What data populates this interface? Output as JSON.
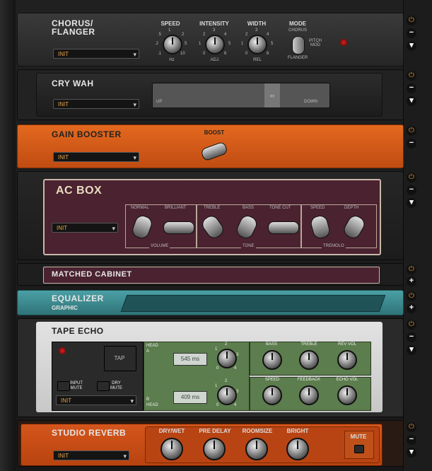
{
  "colors": {
    "orange": "#d35a1a",
    "wah": "#2e2e2e",
    "acbox": "#3a1a22",
    "teal": "#3d8a8f",
    "tape": "#dcdcdc",
    "green": "#5c7d4d"
  },
  "chorus": {
    "title": "CHORUS/\nFLANGER",
    "preset": "INIT",
    "speed": {
      "label": "SPEED",
      "min": ".1",
      "max": "10",
      "unit": "Hz",
      "t1": ".5",
      "t2": "1",
      "t3": "2",
      "t4": "5",
      "t5": ".2"
    },
    "intensity": {
      "label": "INTENSITY",
      "t": [
        "1",
        "2",
        "3",
        "4",
        "5",
        "0",
        "6"
      ],
      "unit": "ADJ."
    },
    "width": {
      "label": "WIDTH",
      "t": [
        "1",
        "2",
        "3",
        "4",
        "5",
        "0",
        "6"
      ],
      "unit": "REL"
    },
    "mode": {
      "label": "MODE",
      "top": "CHORUS",
      "right": "PITCH\nMOD",
      "bottom": "FLANGER"
    }
  },
  "wah": {
    "title": "CRY WAH",
    "preset": "INIT",
    "up": "UP",
    "down": "DOWN"
  },
  "gain": {
    "title": "GAIN BOOSTER",
    "preset": "INIT",
    "boost": "BOOST"
  },
  "acbox": {
    "title": "AC BOX",
    "preset": "INIT",
    "labels": [
      "NORMAL",
      "BRILLIANT",
      "TREBLE",
      "BASS",
      "TONE CUT",
      "SPEED",
      "DEPTH"
    ],
    "groups": [
      "VOLUME",
      "TONE",
      "TREMOLO"
    ]
  },
  "cabinet": {
    "title": "MATCHED CABINET"
  },
  "eq": {
    "title": "EQUALIZER",
    "sub": "GRAPHIC"
  },
  "tape": {
    "title": "TAPE ECHO",
    "preset": "INIT",
    "tap": "TAP",
    "input_mute": "INPUT\nMUTE",
    "dry_mute": "DRY\nMUTE",
    "head_a": "HEAD\nA",
    "head_b": "B\nHEAD",
    "a_ms": "545 ms",
    "b_ms": "409 ms",
    "ticks": [
      "1",
      "2",
      "3",
      "0",
      "4"
    ],
    "tone": [
      "BASS",
      "TREBLE",
      "REV VOL"
    ],
    "fx": [
      "SPEED",
      "FEEDBACK",
      "ECHO VOL"
    ]
  },
  "reverb": {
    "title": "STUDIO REVERB",
    "preset": "INIT",
    "knobs": [
      "DRY/WET",
      "PRE DELAY",
      "ROOMSIZE",
      "BRIGHT"
    ],
    "mute": "MUTE"
  },
  "sidebar": {
    "power": "⏻",
    "minus": "−",
    "plus": "+",
    "down": "▾"
  }
}
